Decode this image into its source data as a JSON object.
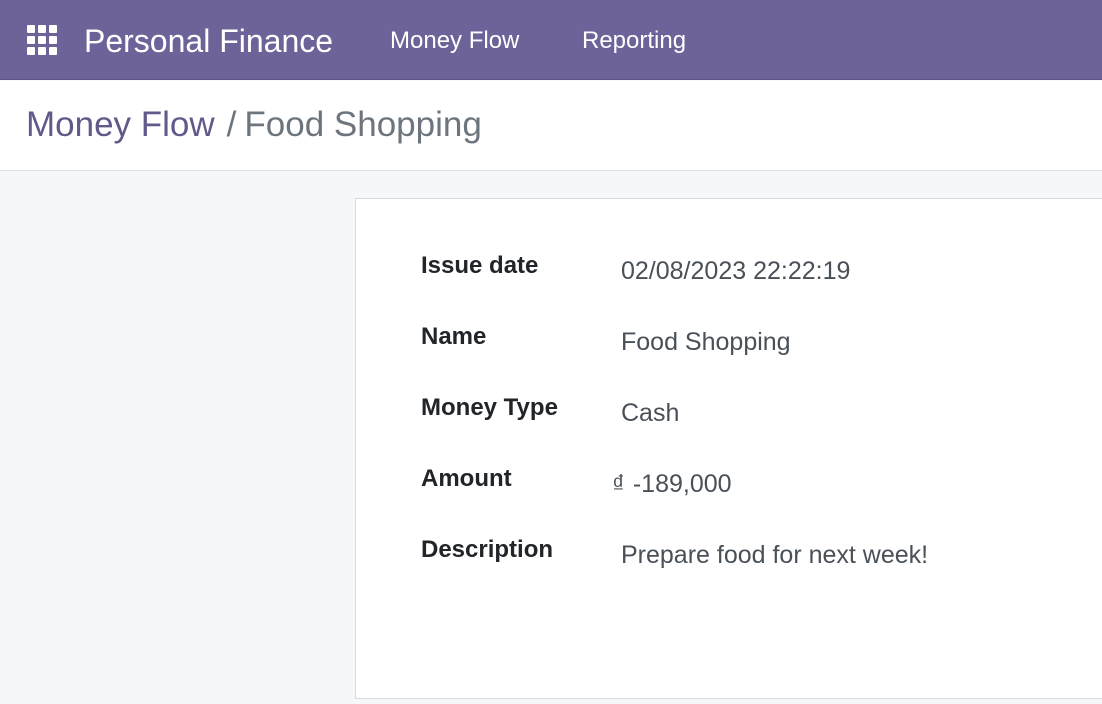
{
  "navbar": {
    "app_name": "Personal Finance",
    "menu": [
      {
        "label": "Money Flow"
      },
      {
        "label": "Reporting"
      }
    ],
    "apps_icon": "apps-grid-icon",
    "color": "#6d6399"
  },
  "breadcrumb": {
    "parent": "Money Flow",
    "separator": "/",
    "current": "Food Shopping"
  },
  "form": {
    "fields": [
      {
        "label": "Issue date",
        "value": "02/08/2023 22:22:19"
      },
      {
        "label": "Name",
        "value": "Food Shopping"
      },
      {
        "label": "Money Type",
        "value": "Cash"
      },
      {
        "label": "Amount",
        "currency": "₫",
        "value": "-189,000"
      },
      {
        "label": "Description",
        "value": "Prepare food for next week!"
      }
    ]
  }
}
